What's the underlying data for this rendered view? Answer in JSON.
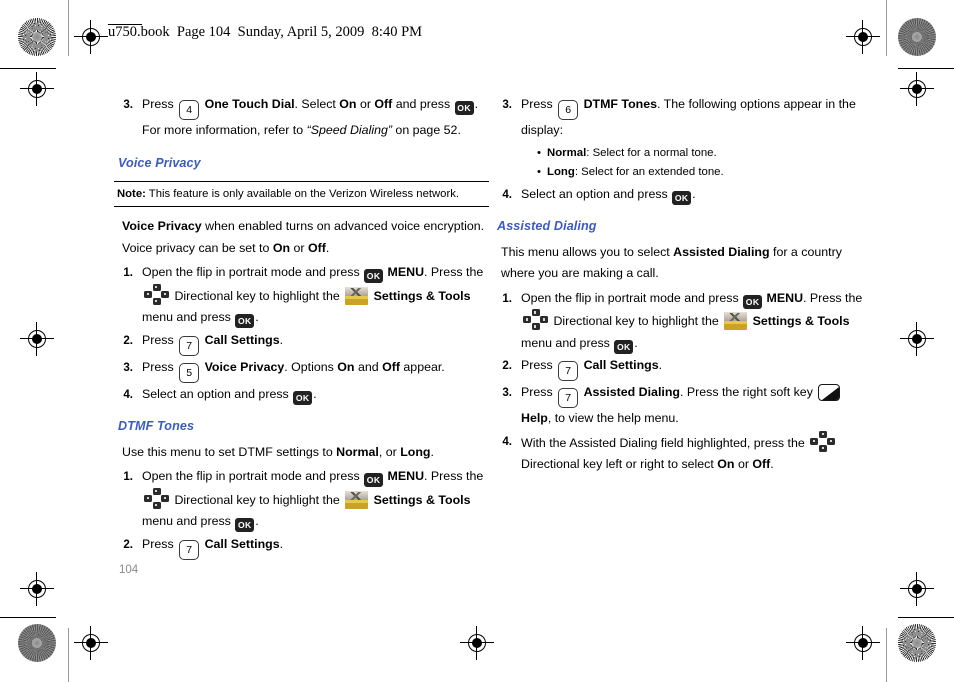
{
  "page": {
    "header_line": "u750.book  Page 104  Sunday, April 5, 2009  8:40 PM",
    "page_number": "104",
    "heading_color": "#3b5bbf"
  },
  "icons": {
    "ok": "OK",
    "dpad_name": "directional-key-icon",
    "settings_name": "settings-and-tools-icon",
    "softkey_name": "right-soft-key-icon"
  },
  "left_column": {
    "top_step": {
      "num": "3.",
      "t1": "Press ",
      "key": "4",
      "t2": " ",
      "b1": "One Touch Dial",
      "t3": ". Select ",
      "b2": "On",
      "t4": " or ",
      "b3": "Off",
      "t5": " and press ",
      "t6": ". For more information, refer to ",
      "quote": "“Speed Dialing”",
      "t7": " on page 52."
    },
    "voice_privacy": {
      "heading": "Voice Privacy",
      "note_label": "Note:",
      "note_text": " This feature is only available on the Verizon Wireless network.",
      "intro": {
        "b1": "Voice Privacy",
        "t1": " when enabled turns on advanced voice encryption. Voice privacy can be set to ",
        "b2": "On",
        "t2": " or ",
        "b3": "Off",
        "t3": "."
      },
      "steps": [
        {
          "num": "1.",
          "t1": "Open the flip in portrait mode and press ",
          "b1": "MENU",
          "t2": ". Press the ",
          "t3": " Directional key to highlight the ",
          "b2": "Settings & Tools",
          "t4": " menu and press ",
          "t5": "."
        },
        {
          "num": "2.",
          "t1": "Press ",
          "key": "7",
          "t2": " ",
          "b1": "Call Settings",
          "t3": "."
        },
        {
          "num": "3.",
          "t1": "Press ",
          "key": "5",
          "t2": " ",
          "b1": "Voice Privacy",
          "t3": ". Options ",
          "b2": "On",
          "t4": " and ",
          "b3": "Off",
          "t5": " appear."
        },
        {
          "num": "4.",
          "t1": "Select an option and press ",
          "t2": "."
        }
      ]
    },
    "dtmf_tones": {
      "heading": "DTMF Tones",
      "intro": {
        "t1": "Use this menu to set DTMF settings to ",
        "b1": "Normal",
        "t2": ", or ",
        "b2": "Long",
        "t3": "."
      },
      "steps": [
        {
          "num": "1.",
          "t1": "Open the flip in portrait mode and press ",
          "b1": "MENU",
          "t2": ". Press the ",
          "t3": " Directional key to highlight the ",
          "b2": "Settings & Tools",
          "t4": " menu and press ",
          "t5": "."
        },
        {
          "num": "2.",
          "t1": "Press ",
          "key": "7",
          "t2": " ",
          "b1": "Call Settings",
          "t3": "."
        }
      ]
    }
  },
  "right_column": {
    "top_step": {
      "num": "3.",
      "t1": "Press ",
      "key": "6",
      "t2": " ",
      "b1": "DTMF Tones",
      "t3": ". The following options appear in the display:"
    },
    "bullets": [
      {
        "dot": "•",
        "b": "Normal",
        "t": ": Select for a normal tone."
      },
      {
        "dot": "•",
        "b": "Long",
        "t": ": Select for an extended tone."
      }
    ],
    "step4": {
      "num": "4.",
      "t1": "Select an option and press ",
      "t2": "."
    },
    "assisted_dialing": {
      "heading": "Assisted Dialing",
      "intro": {
        "t1": "This menu allows you to select ",
        "b1": "Assisted Dialing",
        "t2": " for a country where you are making a call."
      },
      "steps": [
        {
          "num": "1.",
          "t1": "Open the flip in portrait mode and press ",
          "b1": "MENU",
          "t2": ". Press the ",
          "t3": " Directional key to highlight the ",
          "b2": "Settings & Tools",
          "t4": " menu and press ",
          "t5": "."
        },
        {
          "num": "2.",
          "t1": "Press ",
          "key": "7",
          "t2": " ",
          "b1": "Call Settings",
          "t3": "."
        },
        {
          "num": "3.",
          "t1": "Press ",
          "key": "7",
          "t2": " ",
          "b1": "Assisted Dialing",
          "t3": ". Press the right soft key ",
          "b2": "Help",
          "t4": ", to view the help menu."
        },
        {
          "num": "4.",
          "t1": "With the Assisted Dialing field highlighted, press the ",
          "t2": " Directional key left or right to select ",
          "b1": "On",
          "t3": " or ",
          "b2": "Off",
          "t4": "."
        }
      ]
    }
  }
}
